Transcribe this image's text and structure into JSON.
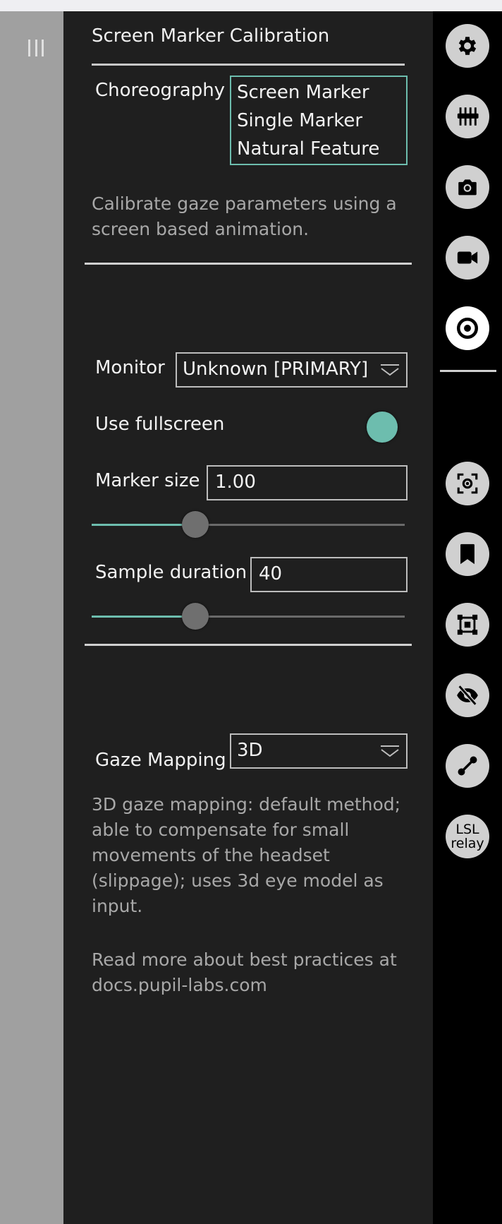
{
  "calibration": {
    "title": "Screen Marker Calibration",
    "choreography_label": "Choreography",
    "choreography_options": [
      "Screen Marker",
      "Single Marker",
      "Natural Feature"
    ],
    "description": "Calibrate gaze parameters using a screen based animation.",
    "monitor_label": "Monitor",
    "monitor_value": "Unknown [PRIMARY]",
    "fullscreen_label": "Use fullscreen",
    "fullscreen_on": true,
    "marker_size_label": "Marker size",
    "marker_size_value": "1.00",
    "sample_duration_label": "Sample duration",
    "sample_duration_value": "40"
  },
  "gaze_mapping": {
    "label": "Gaze Mapping",
    "value": "3D",
    "description": "3D gaze mapping: default method; able to compensate for small movements of the headset (slippage); uses 3d eye model as input.",
    "read_more": "Read more about best practices at docs.pupil-labs.com"
  },
  "icon_bar": {
    "buttons": [
      {
        "icon": "gear-icon"
      },
      {
        "icon": "sliders-icon"
      },
      {
        "icon": "camera-icon"
      },
      {
        "icon": "video-icon"
      },
      {
        "icon": "target-icon",
        "active": true
      },
      {
        "icon": "focus-camera-icon"
      },
      {
        "icon": "bookmark-icon"
      },
      {
        "icon": "surface-tracker-icon"
      },
      {
        "icon": "eye-off-icon"
      },
      {
        "icon": "connection-icon"
      },
      {
        "icon": "lsl-relay-icon",
        "label_line1": "LSL",
        "label_line2": "relay"
      }
    ]
  },
  "colors": {
    "accent": "#6dbdae",
    "panel": "#1f1f1f",
    "sidebar": "#000000",
    "left_strip": "#a0a0a0"
  }
}
